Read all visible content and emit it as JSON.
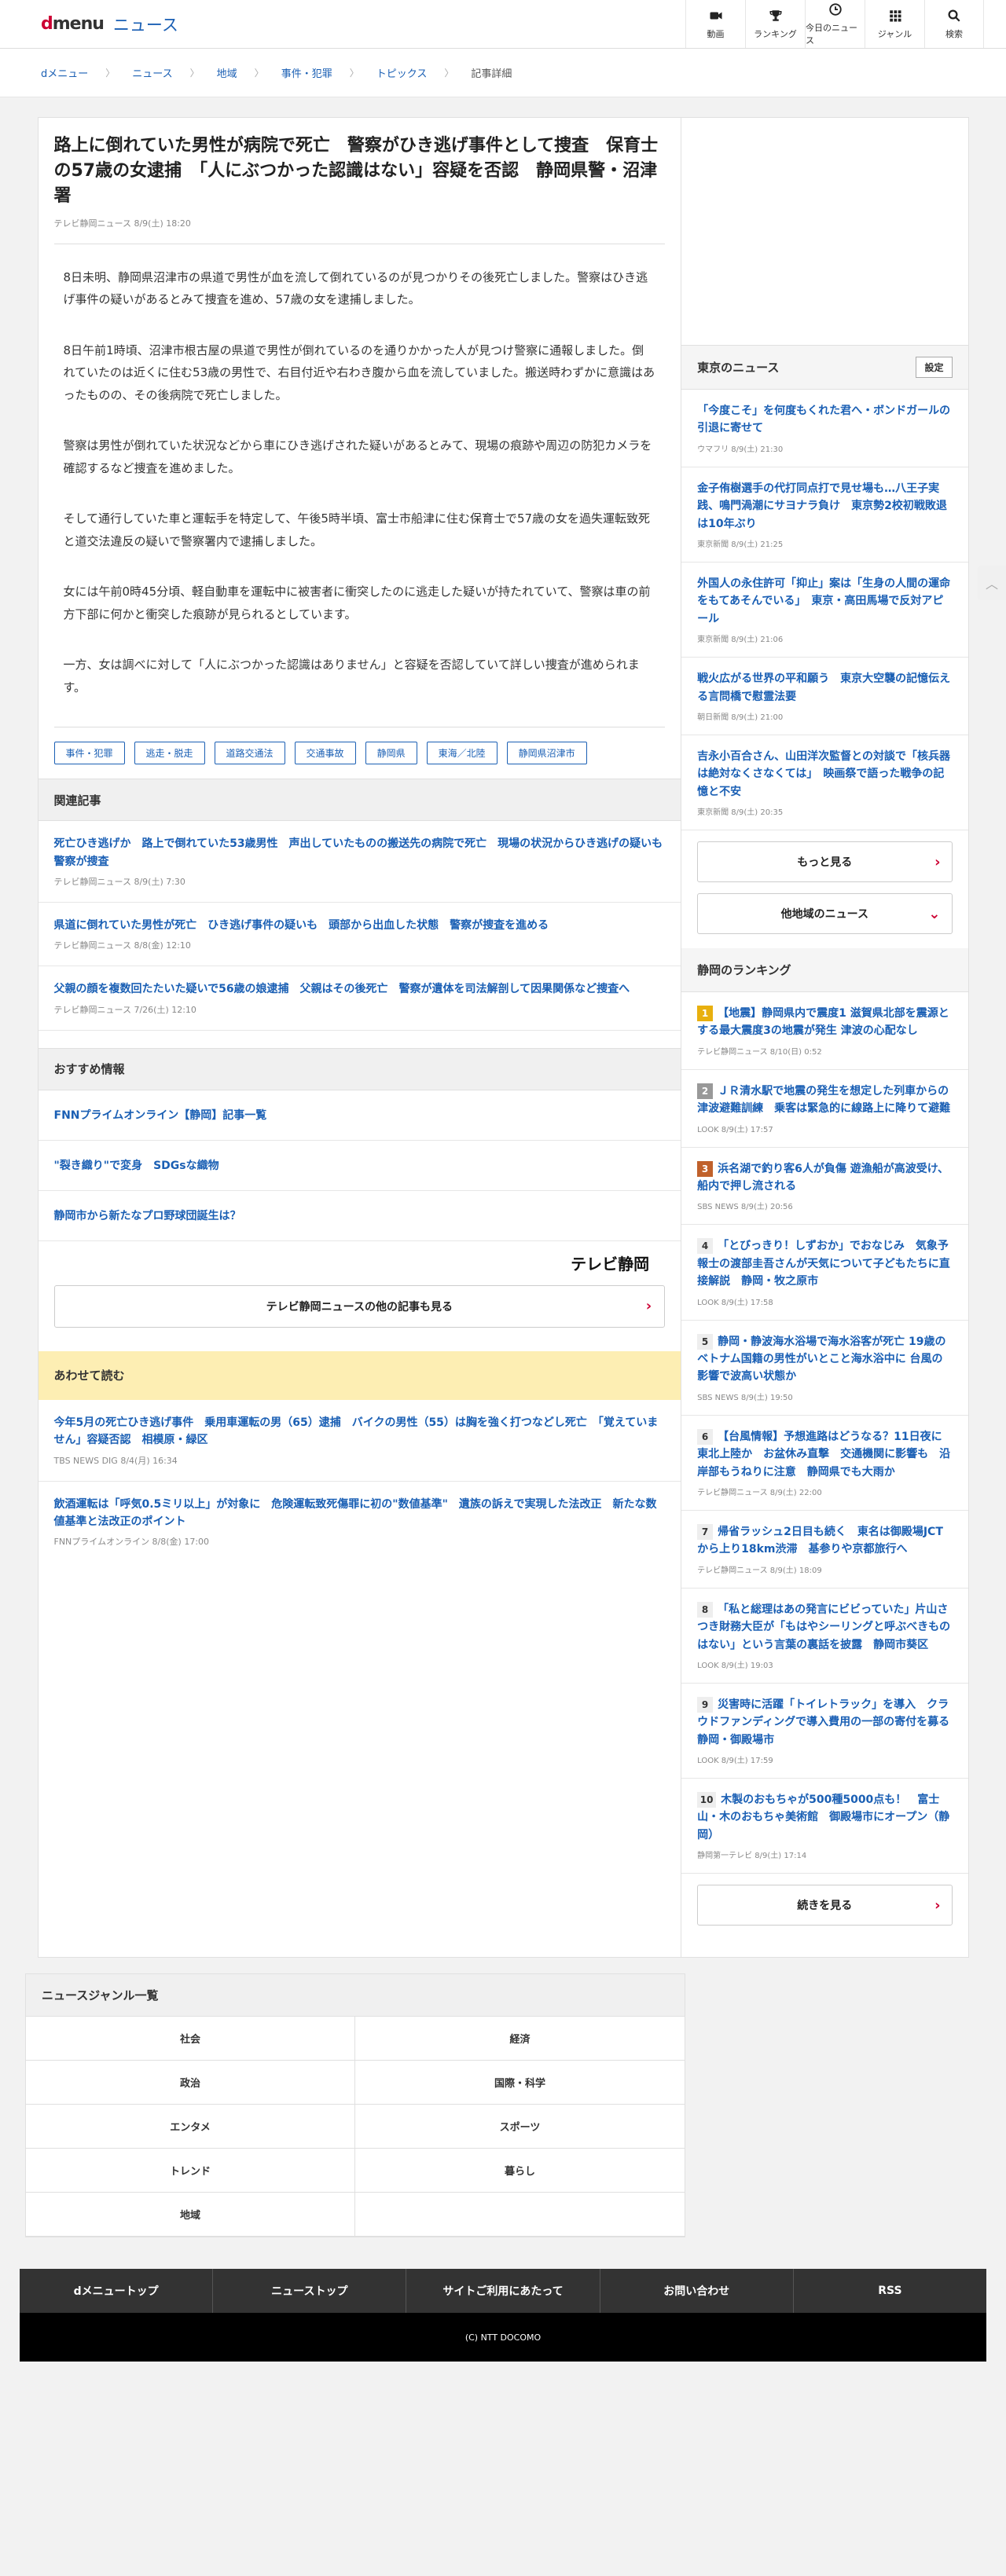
{
  "header": {
    "logo_d": "d",
    "logo_menu": "menu",
    "section": "ニュース",
    "nav": [
      {
        "label": "動画",
        "icon": "video-camera-icon"
      },
      {
        "label": "ランキング",
        "icon": "trophy-icon"
      },
      {
        "label": "今日のニュース",
        "icon": "clock-icon"
      },
      {
        "label": "ジャンル",
        "icon": "grid-icon"
      },
      {
        "label": "検索",
        "icon": "search-icon"
      }
    ]
  },
  "breadcrumb": [
    "dメニュー",
    "ニュース",
    "地域",
    "事件・犯罪",
    "トピックス",
    "記事詳細"
  ],
  "article": {
    "title": "路上に倒れていた男性が病院で死亡　警察がひき逃げ事件として捜査　保育士の57歳の女逮捕　「人にぶつかった認識はない」容疑を否認　静岡県警・沼津署",
    "meta": "テレビ静岡ニュース  8/9(土) 18:20",
    "paragraphs": [
      "8日未明、静岡県沼津市の県道で男性が血を流して倒れているのが見つかりその後死亡しました。警察はひき逃げ事件の疑いがあるとみて捜査を進め、57歳の女を逮捕しました。",
      "8日午前1時頃、沼津市根古屋の県道で男性が倒れているのを通りかかった人が見つけ警察に通報しました。倒れていたのは近くに住む53歳の男性で、右目付近や右わき腹から血を流していました。搬送時わずかに意識はあったものの、その後病院で死亡しました。",
      "警察は男性が倒れていた状況などから車にひき逃げされた疑いがあるとみて、現場の痕跡や周辺の防犯カメラを確認するなど捜査を進めました。",
      "そして通行していた車と運転手を特定して、午後5時半頃、富士市船津に住む保育士で57歳の女を過失運転致死と道交法違反の疑いで警察署内で逮捕しました。",
      "女には午前0時45分頃、軽自動車を運転中に被害者に衝突したのに逃走した疑いが持たれていて、警察は車の前方下部に何かと衝突した痕跡が見られるとしています。",
      "一方、女は調べに対して「人にぶつかった認識はありません」と容疑を否認していて詳しい捜査が進められます。"
    ],
    "tags": [
      "事件・犯罪",
      "逃走・脱走",
      "道路交通法",
      "交通事故",
      "静岡県",
      "東海／北陸",
      "静岡県沼津市"
    ]
  },
  "related": {
    "heading": "関連記事",
    "items": [
      {
        "title": "死亡ひき逃げか　路上で倒れていた53歳男性　声出していたものの搬送先の病院で死亡　現場の状況からひき逃げの疑いも　警察が捜査",
        "meta": "テレビ静岡ニュース  8/9(土) 7:30"
      },
      {
        "title": "県道に倒れていた男性が死亡　ひき逃げ事件の疑いも　頭部から出血した状態　警察が捜査を進める",
        "meta": "テレビ静岡ニュース  8/8(金) 12:10"
      },
      {
        "title": "父親の顔を複数回たたいた疑いで56歳の娘逮捕　父親はその後死亡　警察が遺体を司法解剖して因果関係など捜査へ",
        "meta": "テレビ静岡ニュース  7/26(土) 12:10"
      }
    ]
  },
  "recommend": {
    "heading": "おすすめ情報",
    "items": [
      "FNNプライムオンライン【静岡】記事一覧",
      "\"裂き織り\"で変身　SDGsな織物",
      "静岡市から新たなプロ野球団誕生は？"
    ]
  },
  "source": {
    "logo": "テレビ静岡",
    "more": "テレビ静岡ニュースの他の記事も見る"
  },
  "also_read": {
    "heading": "あわせて読む",
    "items": [
      {
        "title": "今年5月の死亡ひき逃げ事件　乗用車運転の男（65）逮捕　バイクの男性（55）は胸を強く打つなどし死亡　「覚えていません」容疑否認　相模原・緑区",
        "meta": "TBS NEWS DIG  8/4(月) 16:34"
      },
      {
        "title": "飲酒運転は「呼気0.5ミリ以上」が対象に　危険運転致死傷罪に初の\"数値基準\"　遺族の訴えで実現した法改正　新たな数値基準と法改正のポイント",
        "meta": "FNNプライムオンライン  8/8(金) 17:00"
      }
    ]
  },
  "tokyo": {
    "heading": "東京のニュース",
    "settings": "設定",
    "items": [
      {
        "title": "「今度こそ」を何度もくれた君へ・ボンドガールの引退に寄せて",
        "meta": "ウマフリ  8/9(土) 21:30"
      },
      {
        "title": "金子侑樹選手の代打同点打で見せ場も…八王子実践、鳴門渦潮にサヨナラ負け　東京勢2校初戦敗退は10年ぶり",
        "meta": "東京新聞  8/9(土) 21:25"
      },
      {
        "title": "外国人の永住許可「抑止」案は「生身の人間の運命をもてあそんでいる」　東京・高田馬場で反対アピール",
        "meta": "東京新聞  8/9(土) 21:06"
      },
      {
        "title": "戦火広がる世界の平和願う　東京大空襲の記憶伝える言問橋で慰霊法要",
        "meta": "朝日新聞  8/9(土) 21:00"
      },
      {
        "title": "吉永小百合さん、山田洋次監督との対談で「核兵器は絶対なくさなくては」　映画祭で語った戦争の記憶と不安",
        "meta": "東京新聞  8/9(土) 20:35"
      }
    ],
    "more": "もっと見る",
    "other": "他地域のニュース"
  },
  "ranking": {
    "heading": "静岡のランキング",
    "items": [
      {
        "rank": "1",
        "title": "【地震】静岡県内で震度1 滋賀県北部を震源とする最大震度3の地震が発生 津波の心配なし",
        "meta": "テレビ静岡ニュース  8/10(日) 0:52"
      },
      {
        "rank": "2",
        "title": "ＪＲ清水駅で地震の発生を想定した列車からの津波避難訓練　乗客は緊急的に線路上に降りて避難",
        "meta": "LOOK  8/9(土) 17:57"
      },
      {
        "rank": "3",
        "title": "浜名湖で釣り客6人が負傷 遊漁船が高波受け、船内で押し流される",
        "meta": "SBS NEWS  8/9(土) 20:56"
      },
      {
        "rank": "4",
        "title": "「とびっきり！しずおか」でおなじみ　気象予報士の渡部圭吾さんが天気について子どもたちに直接解説　静岡・牧之原市",
        "meta": "LOOK  8/9(土) 17:58"
      },
      {
        "rank": "5",
        "title": "静岡・静波海水浴場で海水浴客が死亡 19歳のベトナム国籍の男性がいとこと海水浴中に 台風の影響で波高い状態か",
        "meta": "SBS NEWS  8/9(土) 19:50"
      },
      {
        "rank": "6",
        "title": "【台風情報】予想進路はどうなる？11日夜に東北上陸か　お盆休み直撃　交通機関に影響も　沿岸部もうねりに注意　静岡県でも大雨か",
        "meta": "テレビ静岡ニュース  8/9(土) 22:00"
      },
      {
        "rank": "7",
        "title": "帰省ラッシュ2日目も続く　東名は御殿場JCTから上り18km渋滞　基参りや京都旅行へ",
        "meta": "テレビ静岡ニュース  8/9(土) 18:09"
      },
      {
        "rank": "8",
        "title": "「私と総理はあの発言にビビっていた」片山さつき財務大臣が「もはやシーリングと呼ぶべきものはない」という言葉の裏話を披露　静岡市葵区",
        "meta": "LOOK  8/9(土) 19:03"
      },
      {
        "rank": "9",
        "title": "災害時に活躍「トイレトラック」を導入　クラウドファンディングで導入費用の一部の寄付を募る　静岡・御殿場市",
        "meta": "LOOK  8/9(土) 17:59"
      },
      {
        "rank": "10",
        "title": "木製のおもちゃが500種5000点も！　富士山・木のおもちゃ美術館　御殿場市にオープン（静岡）",
        "meta": "静岡第一テレビ  8/9(土) 17:14"
      }
    ],
    "more": "続きを見る"
  },
  "genres": {
    "heading": "ニュースジャンル一覧",
    "items": [
      "社会",
      "経済",
      "政治",
      "国際・科学",
      "エンタメ",
      "スポーツ",
      "トレンド",
      "暮らし",
      "地域",
      ""
    ]
  },
  "footer": {
    "links": [
      "dメニュートップ",
      "ニューストップ",
      "サイトご利用にあたって",
      "お問い合わせ",
      "RSS"
    ],
    "copyright": "(C) NTT DOCOMO"
  },
  "colors": {
    "accent": "#cc0033",
    "link": "#1a5fb4",
    "highlight": "#fdeeb3"
  }
}
